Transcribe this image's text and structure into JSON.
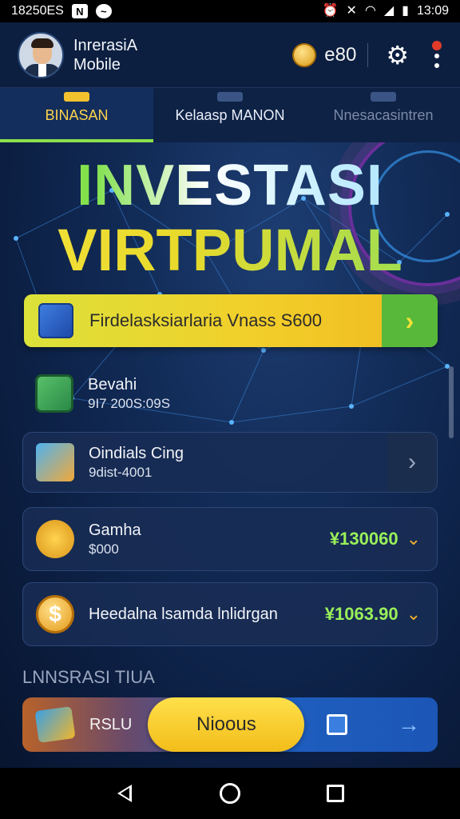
{
  "status_bar": {
    "left_text": "18250ES",
    "time": "13:09",
    "left_icons": [
      "notification-n-icon",
      "messenger-icon"
    ],
    "right_icons": [
      "alarm-icon",
      "mute-icon",
      "wifi-icon",
      "signal-icon",
      "battery-icon"
    ]
  },
  "header": {
    "title_line1": "InrerasiA",
    "title_line2": "Mobile",
    "coin_amount": "e80"
  },
  "tabs": [
    {
      "label": "BINASAN",
      "active": true
    },
    {
      "label": "Kelaasp MANON",
      "active": false
    },
    {
      "label": "Nnesacasintren",
      "active": false
    }
  ],
  "hero": {
    "line1": "INVESTASI",
    "line2": "VIRTPUMAL"
  },
  "banner": {
    "text": "Firdelasksiarlaria Vnass S600"
  },
  "items": [
    {
      "title": "Bevahi",
      "subtitle": "9I7 200S:09S",
      "icon": "balance-icon"
    },
    {
      "title": "Oindials Cing",
      "subtitle": "9dist-4001",
      "icon": "folder-icon"
    },
    {
      "title": "Gamha",
      "subtitle": "$000",
      "value": "¥130060",
      "icon": "plant-coin-icon"
    },
    {
      "title": "Heedalna lsamda lnlidrgan",
      "value": "¥1063.90",
      "icon": "dollar-coin-icon"
    }
  ],
  "section_label": "LNNSRASI TIUA",
  "action_bar": {
    "label": "RSLU",
    "pill_label": "Nioous"
  },
  "colors": {
    "accent_yellow": "#f2cf2a",
    "accent_green": "#8be04c",
    "background": "#0b1d3f",
    "value_green": "#9af05a"
  }
}
